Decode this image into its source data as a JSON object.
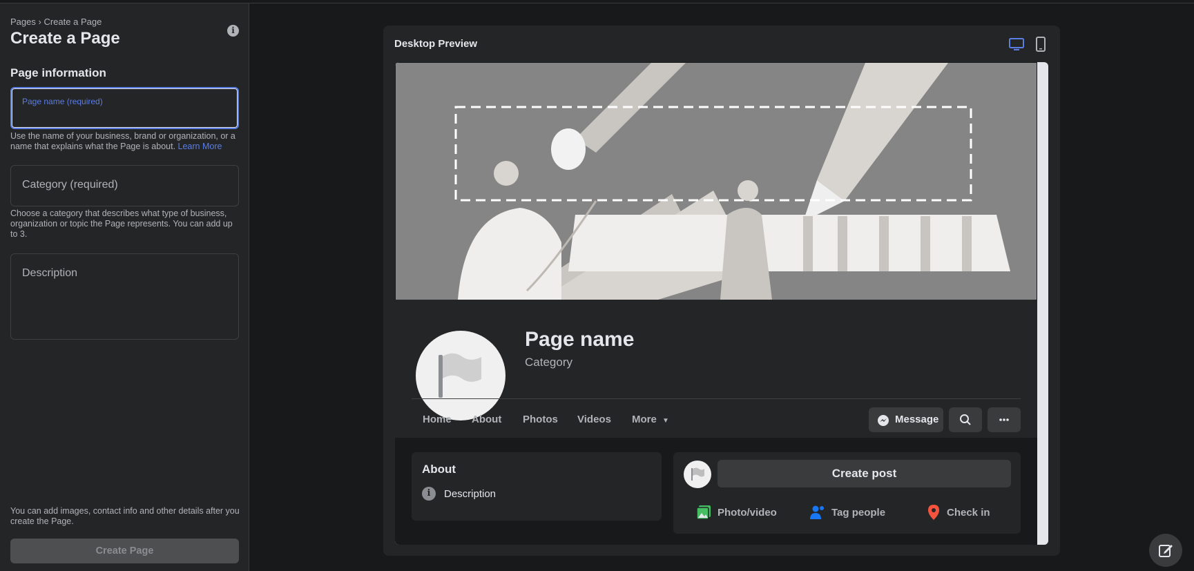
{
  "breadcrumb": [
    "Pages",
    "Create a Page"
  ],
  "breadcrumb_sep": "›",
  "title": "Create a Page",
  "section_title": "Page information",
  "page_name_field": {
    "label": "Page name (required)",
    "value": ""
  },
  "page_name_helper": "Use the name of your business, brand or organization, or a name that explains what the Page is about.",
  "learn_more": "Learn More",
  "category_field": {
    "placeholder": "Category (required)"
  },
  "category_helper": "Choose a category that describes what type of business, organization or topic the Page represents. You can add up to 3.",
  "description_field": {
    "placeholder": "Description"
  },
  "footer_note": "You can add images, contact info and other details after you create the Page.",
  "create_button": "Create Page",
  "preview": {
    "title": "Desktop Preview",
    "page_name": "Page name",
    "category": "Category",
    "tabs": [
      "Home",
      "About",
      "Photos",
      "Videos",
      "More"
    ],
    "message_button": "Message",
    "about_title": "About",
    "about_description": "Description",
    "create_post": "Create post",
    "post_actions": [
      "Photo/video",
      "Tag people",
      "Check in"
    ]
  },
  "colors": {
    "accent": "#5b7ee5",
    "panel": "#242526",
    "bg": "#18191a",
    "photo_green": "#45bd62",
    "tag_blue": "#1877f2",
    "checkin_red": "#f5533d"
  }
}
